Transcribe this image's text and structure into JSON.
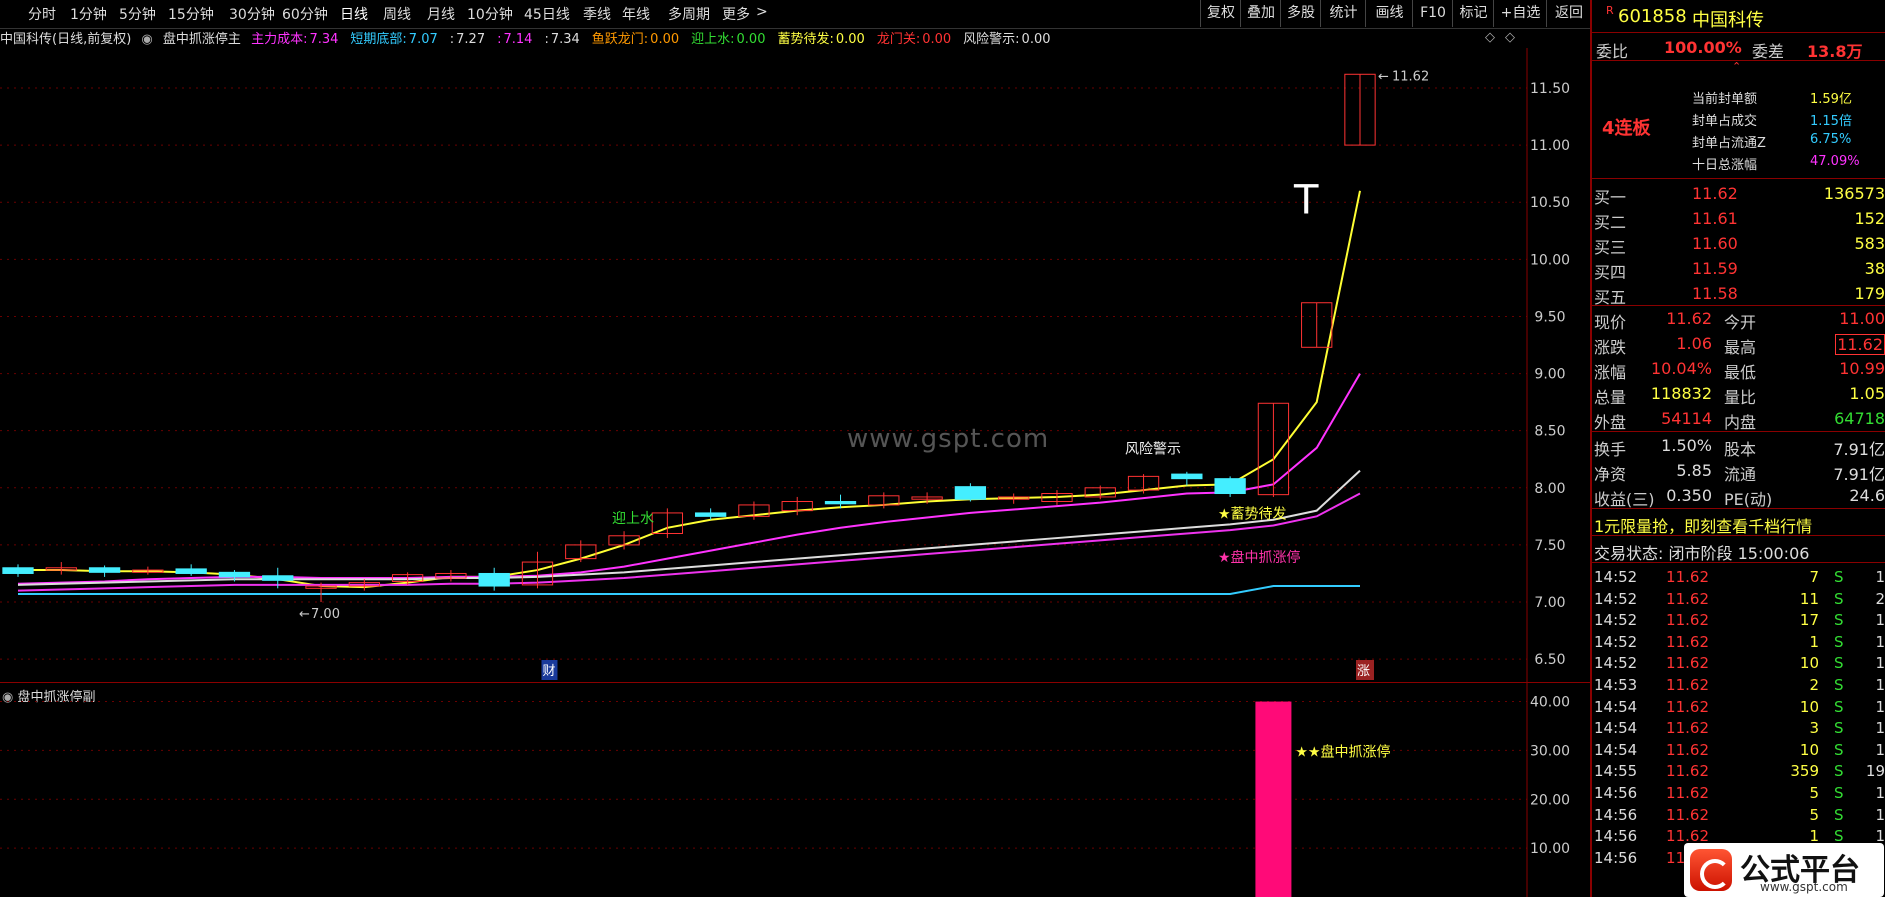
{
  "toolbar": {
    "periods": [
      "分时",
      "1分钟",
      "5分钟",
      "15分钟",
      "30分钟",
      "60分钟",
      "日线",
      "周线",
      "月线",
      "10分钟",
      "45日线",
      "季线",
      "年线",
      "多周期",
      "更多"
    ],
    "active_period": "日线",
    "right_buttons": [
      "复权",
      "叠加",
      "多股",
      "统计",
      "画线",
      "F10",
      "标记",
      "+自选",
      "返回"
    ]
  },
  "indicator_line": {
    "stock_title": "中国科传(日线,前复权)",
    "formula_name": "盘中抓涨停主",
    "items": [
      {
        "label": "主力成本:",
        "value": "7.34",
        "color": "#ff33ff"
      },
      {
        "label": "短期底部:",
        "value": "7.07",
        "color": "#33ccff"
      },
      {
        "label": ":",
        "value": "7.27",
        "color": "#dddddd"
      },
      {
        "label": ":",
        "value": "7.14",
        "color": "#ff33ff"
      },
      {
        "label": ":",
        "value": "7.34",
        "color": "#dddddd"
      },
      {
        "label": "鱼跃龙门:",
        "value": "0.00",
        "color": "#ff9900"
      },
      {
        "label": "迎上水:",
        "value": "0.00",
        "color": "#33dd33"
      },
      {
        "label": "蓄势待发:",
        "value": "0.00",
        "color": "#ffff44"
      },
      {
        "label": "龙门关:",
        "value": "0.00",
        "color": "#ff3333"
      },
      {
        "label": "风险警示:",
        "value": "0.00",
        "color": "#dddddd"
      }
    ]
  },
  "chart_data": [
    {
      "type": "candlestick",
      "title": "盘中抓涨停主",
      "ylim": [
        6.3,
        11.85
      ],
      "y_ticks": [
        "11.50",
        "11.00",
        "10.50",
        "10.00",
        "9.50",
        "9.00",
        "8.50",
        "8.00",
        "7.50",
        "7.00",
        "6.50"
      ],
      "candles": [
        {
          "o": 7.3,
          "c": 7.25,
          "h": 7.33,
          "l": 7.22
        },
        {
          "o": 7.28,
          "c": 7.3,
          "h": 7.35,
          "l": 7.24
        },
        {
          "o": 7.3,
          "c": 7.26,
          "h": 7.32,
          "l": 7.22
        },
        {
          "o": 7.26,
          "c": 7.28,
          "h": 7.31,
          "l": 7.24
        },
        {
          "o": 7.29,
          "c": 7.25,
          "h": 7.33,
          "l": 7.23
        },
        {
          "o": 7.26,
          "c": 7.22,
          "h": 7.28,
          "l": 7.18
        },
        {
          "o": 7.23,
          "c": 7.19,
          "h": 7.3,
          "l": 7.12
        },
        {
          "o": 7.12,
          "c": 7.14,
          "h": 7.17,
          "l": 7.0
        },
        {
          "o": 7.14,
          "c": 7.17,
          "h": 7.2,
          "l": 7.1
        },
        {
          "o": 7.18,
          "c": 7.24,
          "h": 7.26,
          "l": 7.15
        },
        {
          "o": 7.21,
          "c": 7.25,
          "h": 7.28,
          "l": 7.18
        },
        {
          "o": 7.25,
          "c": 7.14,
          "h": 7.3,
          "l": 7.1
        },
        {
          "o": 7.15,
          "c": 7.35,
          "h": 7.44,
          "l": 7.12
        },
        {
          "o": 7.38,
          "c": 7.5,
          "h": 7.54,
          "l": 7.35
        },
        {
          "o": 7.5,
          "c": 7.58,
          "h": 7.62,
          "l": 7.46
        },
        {
          "o": 7.6,
          "c": 7.78,
          "h": 7.82,
          "l": 7.56
        },
        {
          "o": 7.78,
          "c": 7.75,
          "h": 7.82,
          "l": 7.72
        },
        {
          "o": 7.75,
          "c": 7.85,
          "h": 7.88,
          "l": 7.72
        },
        {
          "o": 7.8,
          "c": 7.88,
          "h": 7.92,
          "l": 7.76
        },
        {
          "o": 7.88,
          "c": 7.86,
          "h": 7.94,
          "l": 7.82
        },
        {
          "o": 7.85,
          "c": 7.93,
          "h": 7.96,
          "l": 7.82
        },
        {
          "o": 7.9,
          "c": 7.92,
          "h": 7.96,
          "l": 7.86
        },
        {
          "o": 8.01,
          "c": 7.9,
          "h": 8.04,
          "l": 7.88
        },
        {
          "o": 7.9,
          "c": 7.92,
          "h": 7.95,
          "l": 7.86
        },
        {
          "o": 7.88,
          "c": 7.95,
          "h": 7.98,
          "l": 7.85
        },
        {
          "o": 7.92,
          "c": 8.0,
          "h": 8.02,
          "l": 7.9
        },
        {
          "o": 7.98,
          "c": 8.1,
          "h": 8.12,
          "l": 7.95
        },
        {
          "o": 8.12,
          "c": 8.08,
          "h": 8.14,
          "l": 8.02
        },
        {
          "o": 8.08,
          "c": 7.95,
          "h": 8.1,
          "l": 7.92
        },
        {
          "o": 7.94,
          "c": 8.74,
          "h": 8.74,
          "l": 7.92
        },
        {
          "o": 9.23,
          "c": 9.62,
          "h": 9.62,
          "l": 9.23
        },
        {
          "o": 11.0,
          "c": 11.62,
          "h": 11.62,
          "l": 11.0
        }
      ],
      "series": [
        {
          "name": "主力成本",
          "color": "#ffff33",
          "values": [
            7.28,
            7.28,
            7.27,
            7.27,
            7.26,
            7.24,
            7.2,
            7.14,
            7.13,
            7.17,
            7.22,
            7.22,
            7.28,
            7.38,
            7.5,
            7.65,
            7.72,
            7.76,
            7.8,
            7.83,
            7.85,
            7.88,
            7.9,
            7.91,
            7.92,
            7.94,
            7.98,
            8.02,
            8.03,
            8.25,
            8.75,
            10.6
          ]
        },
        {
          "name": "",
          "color": "#ff33ff",
          "values": [
            7.16,
            7.17,
            7.18,
            7.2,
            7.21,
            7.22,
            7.22,
            7.21,
            7.21,
            7.21,
            7.22,
            7.22,
            7.23,
            7.26,
            7.31,
            7.38,
            7.45,
            7.52,
            7.59,
            7.65,
            7.7,
            7.74,
            7.78,
            7.81,
            7.84,
            7.87,
            7.91,
            7.95,
            7.96,
            8.03,
            8.35,
            9.0
          ]
        },
        {
          "name": "",
          "color": "#dddddd",
          "values": [
            7.15,
            7.16,
            7.17,
            7.18,
            7.19,
            7.2,
            7.2,
            7.2,
            7.2,
            7.2,
            7.21,
            7.21,
            7.22,
            7.24,
            7.26,
            7.29,
            7.32,
            7.35,
            7.38,
            7.41,
            7.44,
            7.47,
            7.5,
            7.53,
            7.56,
            7.59,
            7.62,
            7.65,
            7.68,
            7.72,
            7.8,
            8.15
          ]
        },
        {
          "name": "",
          "color": "#ee33ee",
          "values": [
            7.1,
            7.11,
            7.12,
            7.13,
            7.14,
            7.15,
            7.15,
            7.15,
            7.15,
            7.15,
            7.16,
            7.16,
            7.17,
            7.19,
            7.21,
            7.24,
            7.27,
            7.3,
            7.33,
            7.36,
            7.39,
            7.42,
            7.45,
            7.48,
            7.51,
            7.54,
            7.57,
            7.6,
            7.63,
            7.67,
            7.75,
            7.95
          ]
        },
        {
          "name": "短期底部",
          "color": "#33ccff",
          "values": [
            7.07,
            7.07,
            7.07,
            7.07,
            7.07,
            7.07,
            7.07,
            7.07,
            7.07,
            7.07,
            7.07,
            7.07,
            7.07,
            7.07,
            7.07,
            7.07,
            7.07,
            7.07,
            7.07,
            7.07,
            7.07,
            7.07,
            7.07,
            7.07,
            7.07,
            7.07,
            7.07,
            7.07,
            7.07,
            7.14,
            7.14,
            7.14
          ]
        }
      ],
      "annotations": {
        "low_label": "7.00",
        "high_label": "11.62",
        "risk_label": "风险警示",
        "shangshui_label": "迎上水",
        "xushi_label": "★蓄势待发",
        "zhuazt_label": "★盘中抓涨停",
        "t_mark": "T",
        "bottom_left_mark": "财",
        "bottom_right_mark": "涨"
      }
    },
    {
      "type": "bar",
      "title": "盘中抓涨停副",
      "ylim": [
        0,
        44
      ],
      "y_ticks": [
        "40.00",
        "30.00",
        "20.00",
        "10.00"
      ],
      "values": [
        0,
        0,
        0,
        0,
        0,
        0,
        0,
        0,
        0,
        0,
        0,
        0,
        0,
        0,
        0,
        0,
        0,
        0,
        0,
        0,
        0,
        0,
        0,
        0,
        0,
        0,
        0,
        0,
        0,
        40,
        0,
        0
      ],
      "label": "★★盘中抓涨停"
    }
  ],
  "watermark": "www.gspt.com",
  "quote": {
    "code": "601858",
    "name": "中国科传",
    "r_mark": "R",
    "weibi_label": "委比",
    "weibi_value": "100.00%",
    "weicha_label": "委差",
    "weicha_value": "13.8万",
    "lianban": "4连板",
    "seal_info": [
      {
        "label": "当前封单额",
        "value": "1.59亿",
        "color": "#ffff44"
      },
      {
        "label": "封单占成交",
        "value": "1.15倍",
        "color": "#33ccff"
      },
      {
        "label": "封单占流通Z",
        "value": "6.75%",
        "color": "#33ccff"
      },
      {
        "label": "十日总涨幅",
        "value": "47.09%",
        "color": "#ff33ff"
      }
    ],
    "bids": [
      {
        "label": "买一",
        "price": "11.62",
        "vol": "136573"
      },
      {
        "label": "买二",
        "price": "11.61",
        "vol": "152"
      },
      {
        "label": "买三",
        "price": "11.60",
        "vol": "583"
      },
      {
        "label": "买四",
        "price": "11.59",
        "vol": "38"
      },
      {
        "label": "买五",
        "price": "11.58",
        "vol": "179"
      }
    ],
    "stats": [
      {
        "l1": "现价",
        "v1": "11.62",
        "c1": "#ff3333",
        "l2": "今开",
        "v2": "11.00",
        "c2": "#ff3333"
      },
      {
        "l1": "涨跌",
        "v1": "1.06",
        "c1": "#ff3333",
        "l2": "最高",
        "v2": "11.62",
        "c2": "#ff3333"
      },
      {
        "l1": "涨幅",
        "v1": "10.04%",
        "c1": "#ff3333",
        "l2": "最低",
        "v2": "10.99",
        "c2": "#ff3333"
      },
      {
        "l1": "总量",
        "v1": "118832",
        "c1": "#ffff44",
        "l2": "量比",
        "v2": "1.05",
        "c2": "#ffff44"
      },
      {
        "l1": "外盘",
        "v1": "54114",
        "c1": "#ff3333",
        "l2": "内盘",
        "v2": "64718",
        "c2": "#33dd33"
      }
    ],
    "stats2": [
      {
        "l1": "换手",
        "v1": "1.50%",
        "l2": "股本",
        "v2": "7.91亿"
      },
      {
        "l1": "净资",
        "v1": "5.85",
        "l2": "流通",
        "v2": "7.91亿"
      },
      {
        "l1": "收益(三)",
        "v1": "0.350",
        "l2": "PE(动)",
        "v2": "24.6"
      }
    ],
    "promo": "1元限量抢，即刻查看千档行情",
    "trade_state": "交易状态: 闭市阶段 15:00:06",
    "ticks": [
      {
        "t": "14:52",
        "p": "11.62",
        "v": "7",
        "s": "S",
        "n": "1"
      },
      {
        "t": "14:52",
        "p": "11.62",
        "v": "11",
        "s": "S",
        "n": "2"
      },
      {
        "t": "14:52",
        "p": "11.62",
        "v": "17",
        "s": "S",
        "n": "1"
      },
      {
        "t": "14:52",
        "p": "11.62",
        "v": "1",
        "s": "S",
        "n": "1"
      },
      {
        "t": "14:52",
        "p": "11.62",
        "v": "10",
        "s": "S",
        "n": "1"
      },
      {
        "t": "14:53",
        "p": "11.62",
        "v": "2",
        "s": "S",
        "n": "1"
      },
      {
        "t": "14:54",
        "p": "11.62",
        "v": "10",
        "s": "S",
        "n": "1"
      },
      {
        "t": "14:54",
        "p": "11.62",
        "v": "3",
        "s": "S",
        "n": "1"
      },
      {
        "t": "14:54",
        "p": "11.62",
        "v": "10",
        "s": "S",
        "n": "1"
      },
      {
        "t": "14:55",
        "p": "11.62",
        "v": "359",
        "s": "S",
        "n": "19"
      },
      {
        "t": "14:56",
        "p": "11.62",
        "v": "5",
        "s": "S",
        "n": "1"
      },
      {
        "t": "14:56",
        "p": "11.62",
        "v": "5",
        "s": "S",
        "n": "1"
      },
      {
        "t": "14:56",
        "p": "11.62",
        "v": "1",
        "s": "S",
        "n": "1"
      },
      {
        "t": "14:56",
        "p": "11.62",
        "v": "1",
        "s": "S",
        "n": "1"
      }
    ]
  },
  "logo": {
    "text": "公式平台",
    "url_text": "www.gspt.com"
  },
  "colors": {
    "up": "#ff3333",
    "down": "#44eeff",
    "bg": "#000000",
    "border": "#8a0000"
  }
}
